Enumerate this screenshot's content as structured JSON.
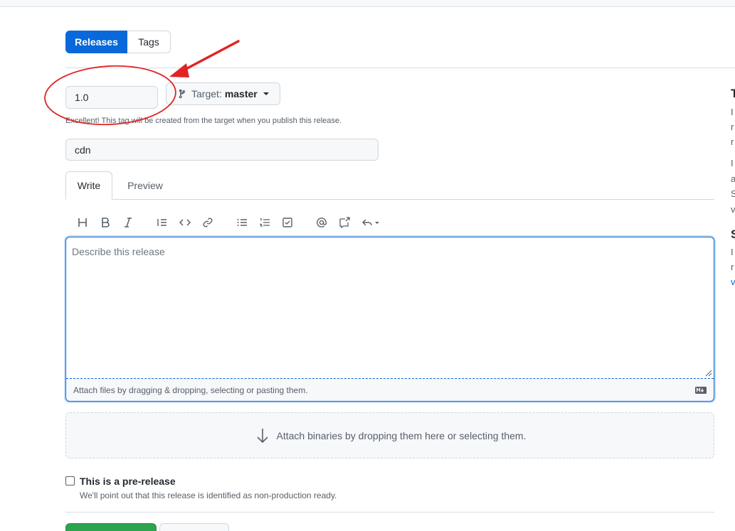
{
  "tabs": {
    "releases": "Releases",
    "tags": "Tags"
  },
  "tag": {
    "value": "1.0"
  },
  "target": {
    "label": "Target:",
    "branch": "master"
  },
  "hint_text": "Excellent! This tag will be created from the target when you publish this release.",
  "release_title": {
    "value": "cdn"
  },
  "editor_tabs": {
    "write": "Write",
    "preview": "Preview"
  },
  "toolbar": [
    "heading-icon",
    "bold-icon",
    "italic-icon",
    "quote-icon",
    "code-icon",
    "link-icon",
    "unordered-list-icon",
    "ordered-list-icon",
    "task-list-icon",
    "mention-icon",
    "reference-icon",
    "reply-icon"
  ],
  "editor": {
    "placeholder": "Describe this release",
    "attach_text": "Attach files by dragging & dropping, selecting or pasting them."
  },
  "dropzone_text": "Attach binaries by dropping them here or selecting them.",
  "prerelease": {
    "label": "This is a pre-release",
    "note": "We'll point out that this release is identified as non-production ready."
  },
  "sidebar_fragments": [
    "T",
    "I",
    "r",
    "r",
    "I",
    "a",
    "S",
    "v",
    "S",
    "I",
    "r",
    "v"
  ],
  "colors": {
    "primary": "#0969da",
    "publish": "#2da44e",
    "annotation": "#e02424"
  }
}
